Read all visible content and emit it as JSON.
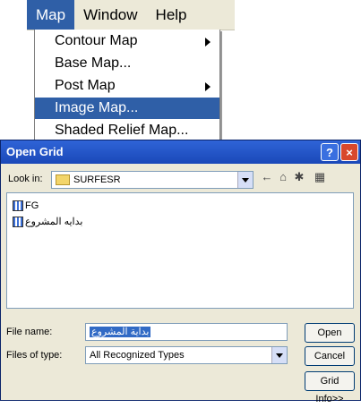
{
  "menubar": {
    "items": [
      "Map",
      "Window",
      "Help"
    ],
    "active_index": 0
  },
  "dropdown": {
    "items": [
      {
        "label": "Contour Map",
        "submenu": true
      },
      {
        "label": "Base Map...",
        "submenu": false
      },
      {
        "label": "Post Map",
        "submenu": true
      },
      {
        "label": "Image Map...",
        "submenu": false,
        "selected": true
      },
      {
        "label": "Shaded Relief Map...",
        "submenu": false
      }
    ]
  },
  "dialog": {
    "title": "Open Grid",
    "help_glyph": "?",
    "close_glyph": "×",
    "look_in_label": "Look in:",
    "look_in_value": "SURFESR",
    "files": [
      {
        "name": "FG"
      },
      {
        "name": "بدايه المشروع"
      }
    ],
    "file_name_label": "File name:",
    "file_name_value": "بداية المشروع",
    "files_of_type_label": "Files of type:",
    "files_of_type_value": "All Recognized Types",
    "open_button": "Open",
    "cancel_button": "Cancel",
    "grid_info_button": "Grid Info>>",
    "toolbar_icons": [
      "back-arrow-icon",
      "up-folder-icon",
      "new-folder-icon",
      "view-menu-icon"
    ]
  },
  "colors": {
    "selection": "#2f5fa7",
    "titlebar": "#1a48b8",
    "dialog_bg": "#ece9d8"
  }
}
